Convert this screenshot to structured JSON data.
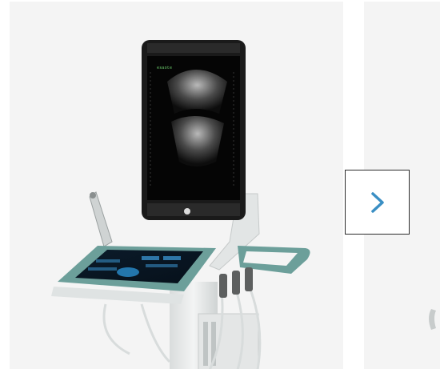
{
  "carousel": {
    "next_button": {
      "icon": "chevron-right-icon",
      "color": "#3a8fc4",
      "border": "#2b2b2b"
    },
    "slides": [
      {
        "image": "ultrasound-system",
        "background": "#f4f4f4"
      },
      {
        "image": "next-product-partial",
        "background": "#f4f4f4"
      }
    ]
  },
  "device": {
    "screen_brand_text": "esaote"
  },
  "colors": {
    "frame": "#1a1a1a",
    "body": "#e8eaea",
    "accent_teal": "#6c9f9a",
    "panel_glow": "#2a8fd0"
  }
}
